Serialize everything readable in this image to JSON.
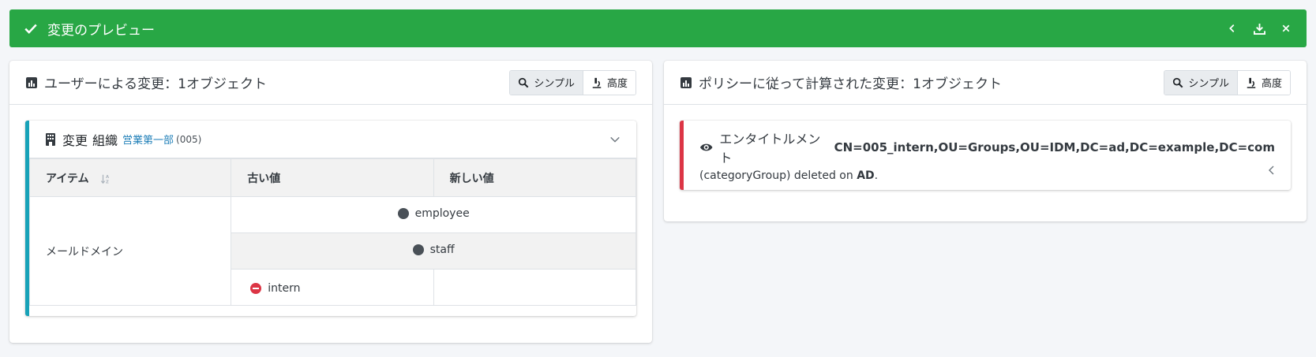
{
  "topbar": {
    "title": "変更のプレビュー",
    "color": "#28a745",
    "icons": [
      "check-icon",
      "chevron-left-icon",
      "download-icon",
      "close-icon"
    ]
  },
  "left_panel": {
    "title": "ユーザーによる変更：1オブジェクト",
    "btn_simple": "シンプル",
    "btn_advanced": "高度",
    "change": {
      "action": "変更",
      "type": "組織",
      "name": "営業第一部",
      "oid": "(005)",
      "accent": "#17a2b8",
      "table": {
        "headers": [
          "アイテム",
          "古い値",
          "新しい値"
        ],
        "item": "メールドメイン",
        "values": [
          {
            "text": "employee",
            "state": "unchanged"
          },
          {
            "text": "staff",
            "state": "unchanged"
          },
          {
            "text": "intern",
            "state": "removed"
          }
        ]
      }
    }
  },
  "right_panel": {
    "title": "ポリシーに従って計算された変更：1オブジェクト",
    "btn_simple": "シンプル",
    "btn_advanced": "高度",
    "entitlement": {
      "label": "エンタイトルメント",
      "dn": "CN=005_intern,OU=Groups,OU=IDM,DC=ad,DC=example,DC=com",
      "desc_prefix": "(categoryGroup) deleted on ",
      "system": "AD",
      "desc_suffix": ".",
      "accent": "#dc3545"
    }
  }
}
